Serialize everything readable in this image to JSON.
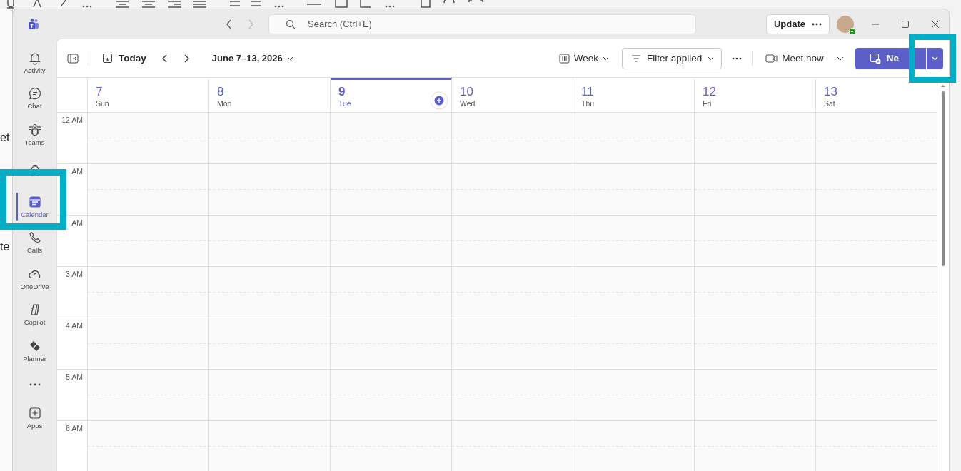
{
  "background_app": {
    "side_texts": [
      "et",
      "te"
    ]
  },
  "window": {
    "search": {
      "placeholder": "Search (Ctrl+E)"
    },
    "update_button": {
      "label": "Update"
    },
    "account": {
      "online": true
    }
  },
  "sidebar": {
    "items": [
      {
        "kind": "bell",
        "label": "Activity",
        "selected": false
      },
      {
        "kind": "chat",
        "label": "Chat",
        "selected": false
      },
      {
        "kind": "teams",
        "label": "Teams",
        "selected": false
      },
      {
        "kind": "backpack",
        "selected": false
      },
      {
        "kind": "calendar",
        "label": "Calendar",
        "selected": true,
        "highlighted": true
      },
      {
        "kind": "phone",
        "label": "Calls",
        "selected": false
      },
      {
        "kind": "cloud",
        "label": "OneDrive",
        "selected": false
      },
      {
        "kind": "copilot",
        "label": "Copilot",
        "selected": false
      },
      {
        "kind": "planner",
        "label": "Planner",
        "selected": false
      },
      {
        "kind": "more",
        "selected": false
      },
      {
        "kind": "apps",
        "label": "Apps",
        "selected": false
      }
    ]
  },
  "toolbar": {
    "today": "Today",
    "date_range": "June 7–13, 2026",
    "view": "Week",
    "filter": "Filter applied",
    "meet_now": "Meet now",
    "new_button": {
      "label": "Ne",
      "highlighted": true
    }
  },
  "days": [
    {
      "number": "7",
      "weekday": "Sun",
      "selected": false
    },
    {
      "number": "8",
      "weekday": "Mon",
      "selected": false
    },
    {
      "number": "9",
      "weekday": "Tue",
      "selected": true
    },
    {
      "number": "10",
      "weekday": "Wed",
      "selected": false
    },
    {
      "number": "11",
      "weekday": "Thu",
      "selected": false
    },
    {
      "number": "12",
      "weekday": "Fri",
      "selected": false
    },
    {
      "number": "13",
      "weekday": "Sat",
      "selected": false
    }
  ],
  "hours": [
    "12 AM",
    "AM",
    "AM",
    "3 AM",
    "4 AM",
    "5 AM",
    "6 AM"
  ]
}
